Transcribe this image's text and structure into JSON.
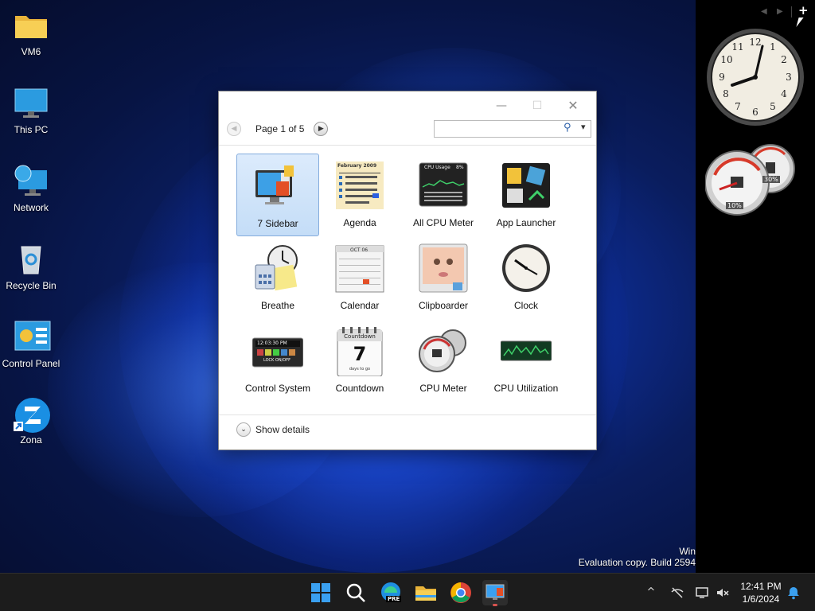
{
  "desktop": {
    "icons": [
      {
        "label": "VM6",
        "icon": "folder-icon"
      },
      {
        "label": "This PC",
        "icon": "monitor-icon"
      },
      {
        "label": "Network",
        "icon": "network-icon"
      },
      {
        "label": "Recycle Bin",
        "icon": "recycle-bin-icon"
      },
      {
        "label": "Control Panel",
        "icon": "control-panel-icon"
      },
      {
        "label": "Zona",
        "icon": "zona-icon"
      }
    ]
  },
  "sidebar": {
    "prev_glyph": "◀",
    "next_glyph": "▶",
    "add_glyph": "+",
    "cpu_meter": {
      "cpu_label": "10%",
      "memory_label": "30%"
    }
  },
  "gallery": {
    "page_label": "Page 1 of 5",
    "search_placeholder": "",
    "minimize_glyph": "—",
    "maximize_glyph": "☐",
    "close_glyph": "✕",
    "prev_glyph": "◀",
    "next_glyph": "▶",
    "search_glyph": "⚲",
    "dropdown_glyph": "▾",
    "gadgets": [
      {
        "label": "7 Sidebar",
        "icon": "7-sidebar-icon",
        "selected": true
      },
      {
        "label": "Agenda",
        "icon": "agenda-icon"
      },
      {
        "label": "All CPU Meter",
        "icon": "all-cpu-meter-icon"
      },
      {
        "label": "App Launcher",
        "icon": "app-launcher-icon"
      },
      {
        "label": "Breathe",
        "icon": "breathe-icon"
      },
      {
        "label": "Calendar",
        "icon": "calendar-icon"
      },
      {
        "label": "Clipboarder",
        "icon": "clipboarder-icon"
      },
      {
        "label": "Clock",
        "icon": "clock-icon"
      },
      {
        "label": "Control System",
        "icon": "control-system-icon"
      },
      {
        "label": "Countdown",
        "icon": "countdown-icon"
      },
      {
        "label": "CPU Meter",
        "icon": "cpu-meter-icon"
      },
      {
        "label": "CPU Utilization",
        "icon": "cpu-utilization-icon"
      }
    ],
    "agenda_icon": {
      "month": "February 2009"
    },
    "cpu_icon": {
      "title": "CPU Usage",
      "value": "8%"
    },
    "calendar_icon": {
      "month": "OCT 06"
    },
    "control_system_icon": {
      "time": "12:03:30 PM",
      "lock": "LOCK ON/OFF"
    },
    "countdown_icon": {
      "title": "Countdown",
      "number": "7",
      "footer": "days to go"
    },
    "details": {
      "label": "Show details",
      "chevron_glyph": "⌄"
    }
  },
  "watermark": {
    "line1": "Win",
    "line2": "Evaluation copy. Build 2594"
  },
  "taskbar": {
    "time": "12:41 PM",
    "date": "1/6/2024",
    "edge_badge": "PRE",
    "tray_chevron_glyph": "^"
  },
  "colors": {
    "accent": "#0078d4",
    "sidebar": "#000000",
    "taskbar": "#1c1c1c"
  }
}
